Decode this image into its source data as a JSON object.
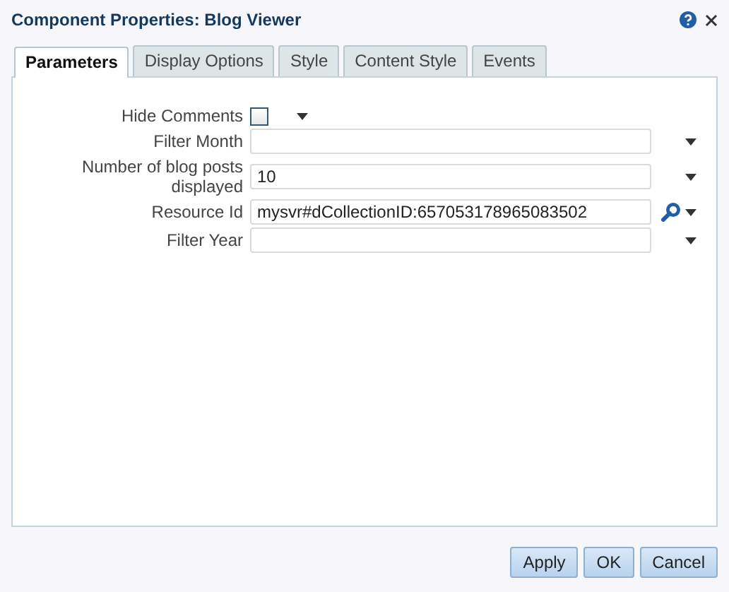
{
  "window": {
    "title": "Component Properties: Blog Viewer"
  },
  "tabs": [
    {
      "label": "Parameters",
      "selected": true
    },
    {
      "label": "Display Options",
      "selected": false
    },
    {
      "label": "Style",
      "selected": false
    },
    {
      "label": "Content Style",
      "selected": false
    },
    {
      "label": "Events",
      "selected": false
    }
  ],
  "fields": [
    {
      "kind": "checkbox",
      "label": "Hide Comments",
      "checked": false
    },
    {
      "kind": "text",
      "label": "Filter Month"
    },
    {
      "kind": "text",
      "label": "Number of blog posts displayed",
      "value": "10"
    },
    {
      "kind": "search",
      "label": "Resource Id",
      "value": "mysvr#dCollectionID:657053178965083502"
    },
    {
      "kind": "text",
      "label": "Filter Year"
    }
  ],
  "buttons": [
    "Apply",
    "OK",
    "Cancel"
  ]
}
